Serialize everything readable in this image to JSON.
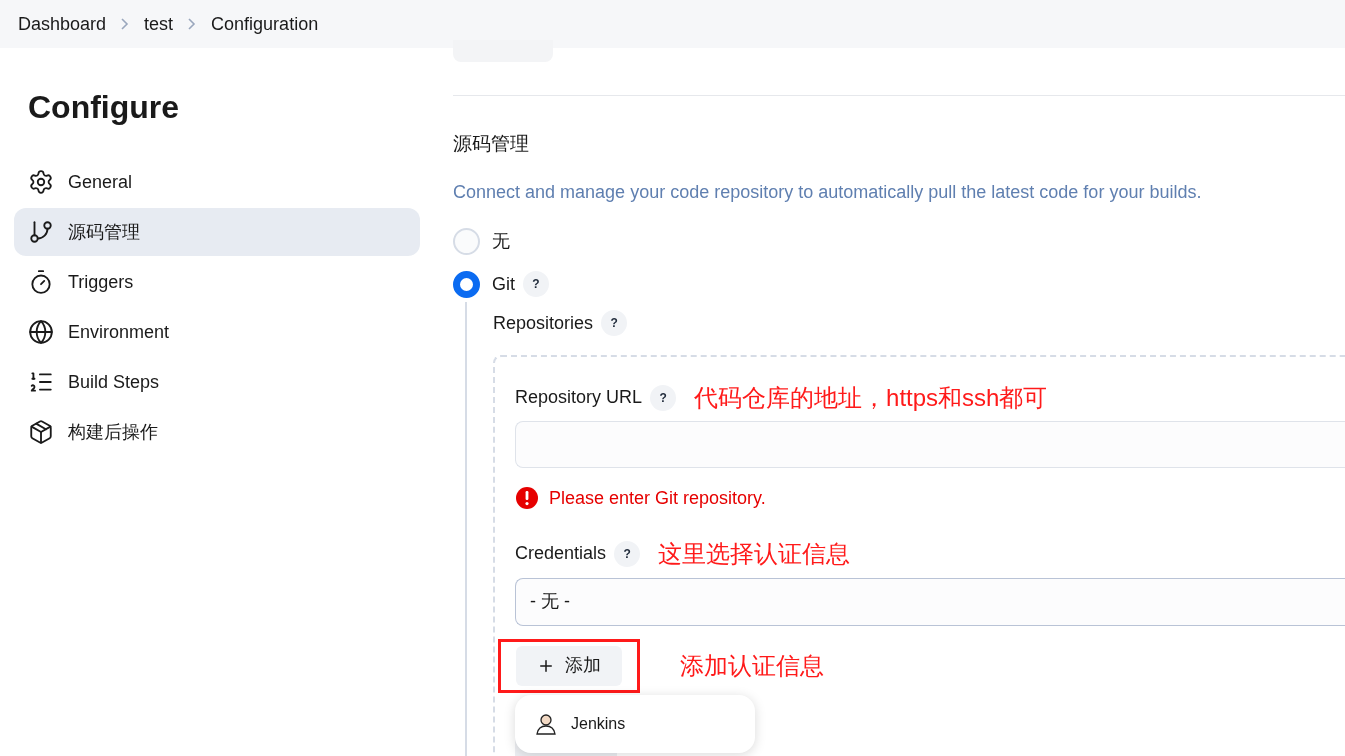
{
  "breadcrumbs": [
    {
      "label": "Dashboard"
    },
    {
      "label": "test"
    },
    {
      "label": "Configuration"
    }
  ],
  "sidebar": {
    "title": "Configure",
    "items": [
      {
        "label": "General",
        "selected": false
      },
      {
        "label": "源码管理",
        "selected": true
      },
      {
        "label": "Triggers",
        "selected": false
      },
      {
        "label": "Environment",
        "selected": false
      },
      {
        "label": "Build Steps",
        "selected": false
      },
      {
        "label": "构建后操作",
        "selected": false
      }
    ]
  },
  "section": {
    "title": "源码管理",
    "description": "Connect and manage your code repository to automatically pull the latest code for your builds.",
    "options": [
      {
        "label": "无",
        "selected": false
      },
      {
        "label": "Git",
        "help": "?",
        "selected": true
      }
    ],
    "repositories": {
      "label": "Repositories",
      "help": "?"
    },
    "repository_url": {
      "label": "Repository URL",
      "help": "?",
      "annotation": "代码仓库的地址，https和ssh都可",
      "error": "Please enter Git repository."
    },
    "credentials": {
      "label": "Credentials",
      "help": "?",
      "annotation": "这里选择认证信息",
      "value": "- 无 -"
    },
    "add_button": {
      "label": "添加",
      "highlighted": true,
      "annotation": "添加认证信息"
    },
    "menu": {
      "items": [
        {
          "label": "Jenkins"
        }
      ]
    }
  }
}
